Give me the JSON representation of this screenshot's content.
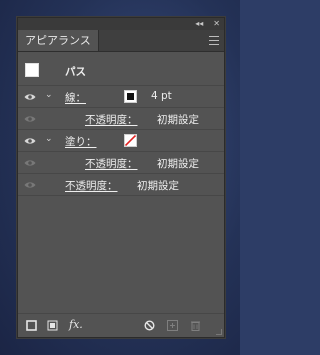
{
  "window": {
    "collapse_icon": "collapse-icon",
    "close_icon": "close-icon"
  },
  "tabs": [
    {
      "label": "アピアランス"
    }
  ],
  "appearance": {
    "object_label": "パス",
    "stroke": {
      "label": "線：",
      "weight": "4 pt",
      "color": "#111111",
      "opacity_label": "不透明度：",
      "opacity_value": "初期設定"
    },
    "fill": {
      "label": "塗り：",
      "color": "none",
      "opacity_label": "不透明度：",
      "opacity_value": "初期設定"
    },
    "object_opacity_label": "不透明度：",
    "object_opacity_value": "初期設定"
  },
  "footer": {
    "icons": [
      "add-stroke-icon",
      "add-fill-icon",
      "fx-icon",
      "clear-appearance-icon",
      "duplicate-item-icon",
      "delete-item-icon"
    ],
    "fx_label": "fx."
  }
}
